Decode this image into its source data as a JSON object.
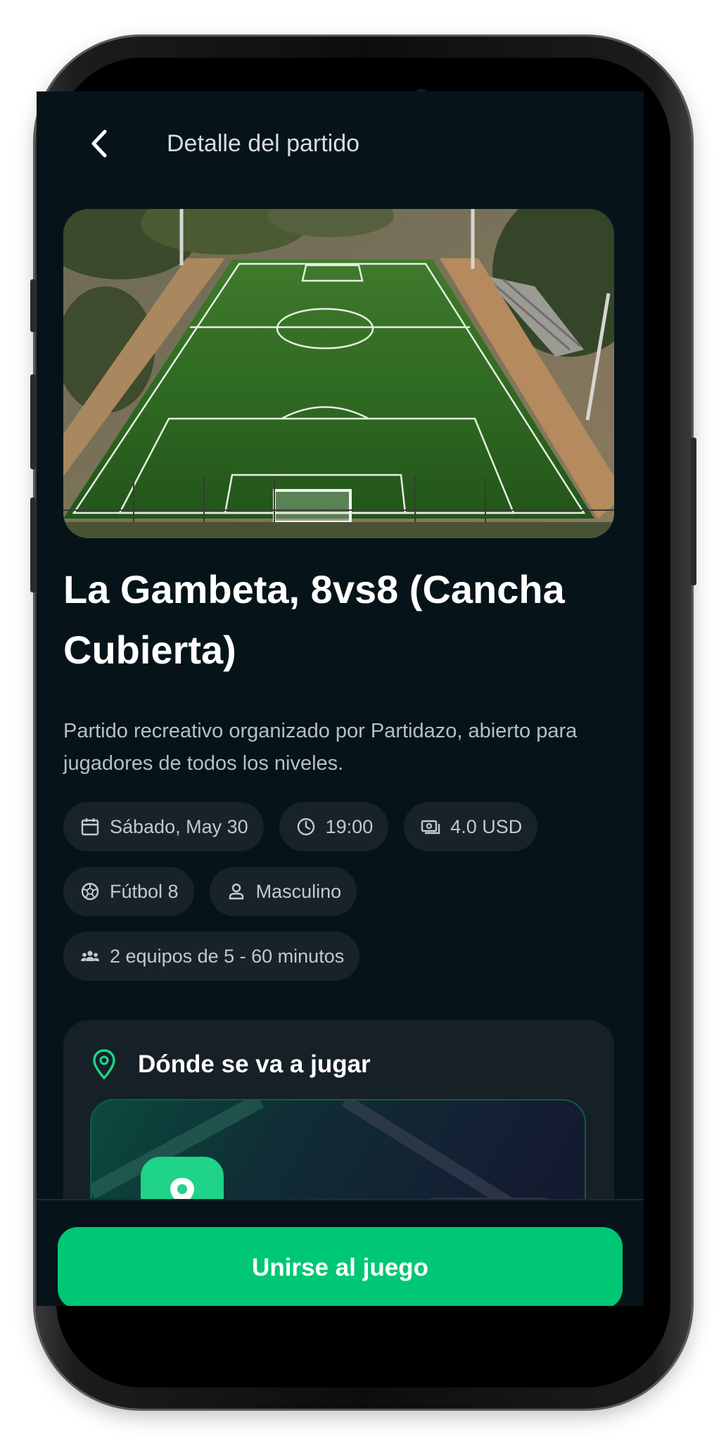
{
  "header": {
    "title": "Detalle del partido",
    "back_icon": "chevron-left-icon"
  },
  "hero": {
    "image": "aerial view of football field"
  },
  "match": {
    "title": "La Gambeta, 8vs8 (Cancha Cubierta)",
    "description": "Partido recreativo organizado por Partidazo, abierto para jugadores de todos los niveles."
  },
  "chips": {
    "date": "Sábado, May 30",
    "time": "19:00",
    "price": "4.0 USD",
    "sport": "Fútbol 8",
    "gender": "Masculino",
    "format": "2 equipos de 5 - 60 minutos"
  },
  "location": {
    "title": "Dónde se va a jugar",
    "pin_icon": "location-pin-icon"
  },
  "cta": {
    "label": "Unirse al juego"
  },
  "colors": {
    "background": "#06141a",
    "card": "#162127",
    "chip": "#172329",
    "accent": "#00c774",
    "text": "#ffffff"
  }
}
